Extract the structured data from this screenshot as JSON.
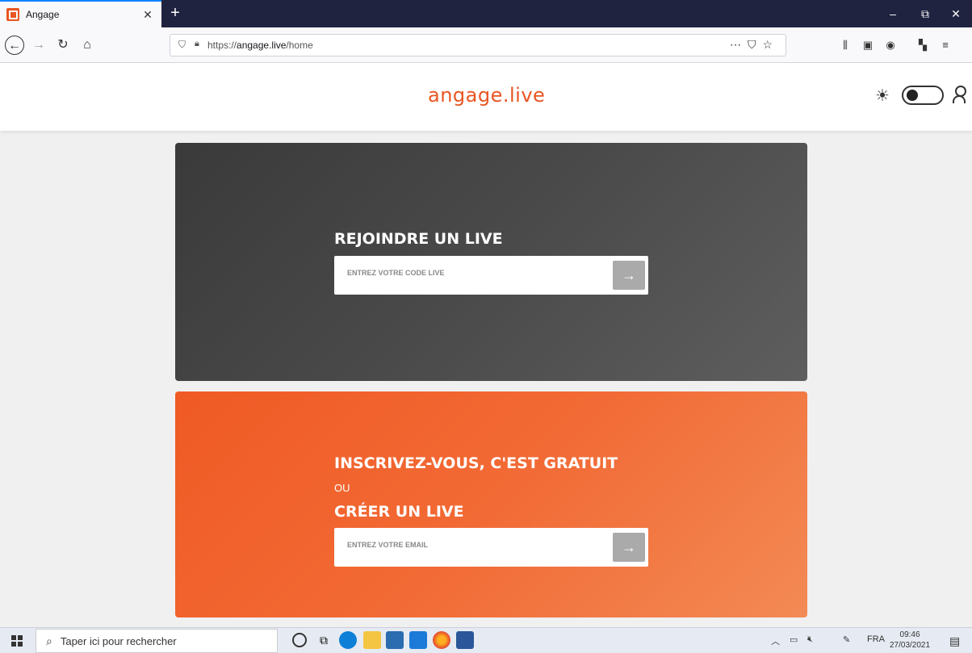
{
  "browser": {
    "tab_title": "Angage",
    "url_prefix": "https://",
    "url_domain": "angage.live",
    "url_path": "/home",
    "minimize": "–",
    "restore": "⧉",
    "close": "✕"
  },
  "site": {
    "logo": "angage.live",
    "theme_icon": "☀"
  },
  "join": {
    "title": "REJOINDRE UN LIVE",
    "placeholder": "ENTREZ VOTRE CODE LIVE",
    "submit": "→"
  },
  "signup": {
    "title": "INSCRIVEZ-VOUS, C'EST GRATUIT",
    "or": "OU",
    "title2": "CRÉER UN LIVE",
    "placeholder": "ENTREZ VOTRE EMAIL",
    "submit": "→"
  },
  "taskbar": {
    "search_placeholder": "Taper ici pour rechercher",
    "lang": "FRA",
    "time": "09:46",
    "date": "27/03/2021"
  },
  "colors": {
    "brand": "#e85522",
    "dark_card": "#454545",
    "orange_card": "#f26a35"
  }
}
